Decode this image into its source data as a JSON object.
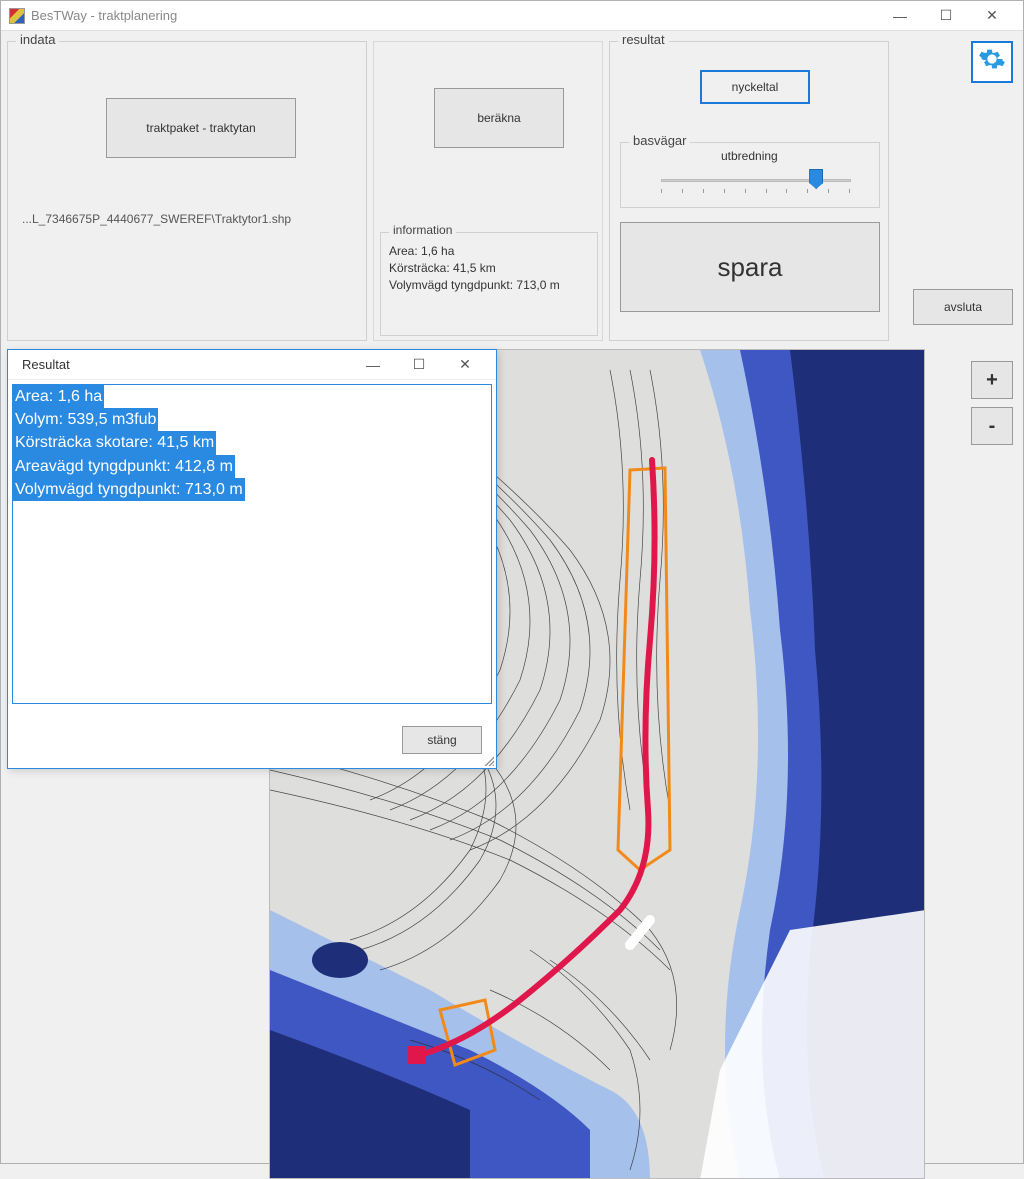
{
  "window": {
    "title": "BesTWay - traktplanering",
    "minimize": "—",
    "maximize": "☐",
    "close": "✕"
  },
  "indata": {
    "group_title": "indata",
    "traktpaket_label": "traktpaket - traktytan",
    "filepath": "...L_7346675P_4440677_SWEREF\\Traktytor1.shp"
  },
  "berakna": {
    "button_label": "beräkna",
    "info_group_title": "information",
    "info_line1": "Area: 1,6 ha",
    "info_line2": "Körsträcka: 41,5 km",
    "info_line3": "Volymvägd tyngdpunkt: 713,0 m"
  },
  "resultat": {
    "group_title": "resultat",
    "nyckeltal_label": "nyckeltal",
    "basvagar_group_title": "basvägar",
    "utbredning_label": "utbredning",
    "slider_percent": 78,
    "spara_label": "spara"
  },
  "sidebar": {
    "avsluta_label": "avsluta",
    "zoom_in": "+",
    "zoom_out": "-"
  },
  "dialog": {
    "title": "Resultat",
    "minimize": "—",
    "maximize": "☐",
    "close": "✕",
    "lines": {
      "l1": "Area: 1,6 ha",
      "l2": "Volym: 539,5 m3fub",
      "l3": "Körsträcka skotare: 41,5 km",
      "l4": "Areavägd tyngdpunkt: 412,8 m",
      "l5": "Volymvägd tyngdpunkt: 713,0 m"
    },
    "close_btn": "stäng"
  },
  "map": {
    "colors": {
      "deep": "#1e2e78",
      "mid": "#3f57c2",
      "light": "#a6c0ec",
      "land": "#dedfdd",
      "contour": "#2b2b2b",
      "route": "#e0174a",
      "zone": "#f28a1a"
    }
  }
}
